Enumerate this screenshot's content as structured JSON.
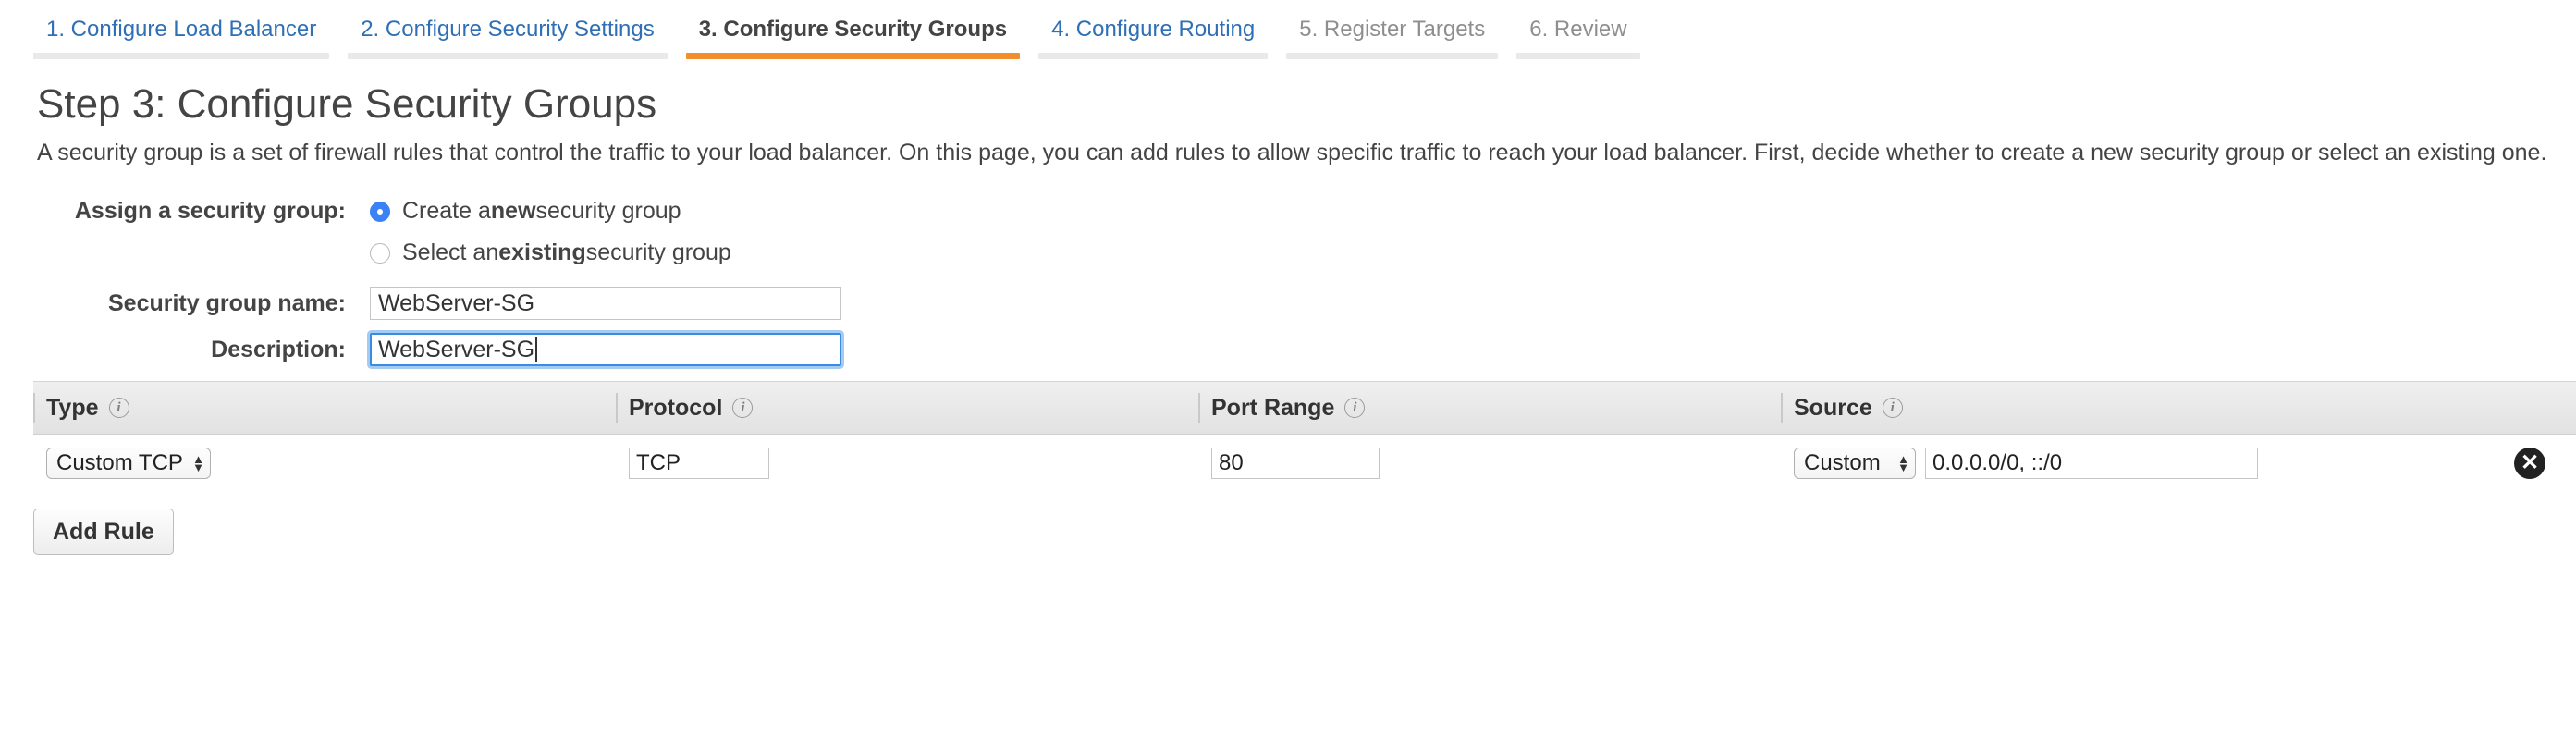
{
  "wizard": {
    "tabs": [
      {
        "label": "1. Configure Load Balancer",
        "state": "link"
      },
      {
        "label": "2. Configure Security Settings",
        "state": "link"
      },
      {
        "label": "3. Configure Security Groups",
        "state": "active"
      },
      {
        "label": "4. Configure Routing",
        "state": "link"
      },
      {
        "label": "5. Register Targets",
        "state": "muted"
      },
      {
        "label": "6. Review",
        "state": "muted"
      }
    ]
  },
  "page": {
    "heading": "Step 3: Configure Security Groups",
    "description": "A security group is a set of firewall rules that control the traffic to your load balancer. On this page, you can add rules to allow specific traffic to reach your load balancer. First, decide whether to create a new security group or select an existing one."
  },
  "form": {
    "assign_label": "Assign a security group:",
    "radio_new_pre": "Create a ",
    "radio_new_strong": "new",
    "radio_new_post": " security group",
    "radio_existing_pre": "Select an ",
    "radio_existing_strong": "existing",
    "radio_existing_post": " security group",
    "selected_option": "new",
    "name_label": "Security group name:",
    "name_value": "WebServer-SG",
    "description_label": "Description:",
    "description_value": "WebServer-SG",
    "description_focused": true
  },
  "rules_table": {
    "columns": [
      {
        "label": "Type",
        "info": "info-icon"
      },
      {
        "label": "Protocol",
        "info": "info-icon"
      },
      {
        "label": "Port Range",
        "info": "info-icon"
      },
      {
        "label": "Source",
        "info": "info-icon"
      }
    ],
    "rows": [
      {
        "type": "Custom TCP I",
        "protocol": "TCP",
        "port_range": "80",
        "source_scope": "Custom",
        "source_value": "0.0.0.0/0, ::/0",
        "delete_glyph": "✕"
      }
    ]
  },
  "actions": {
    "add_rule_label": "Add Rule"
  },
  "colors": {
    "accent_active": "#f28f2c",
    "link": "#2f6fb5",
    "radio_selected": "#3b82f6",
    "focus_ring": "#3b8ce0"
  }
}
